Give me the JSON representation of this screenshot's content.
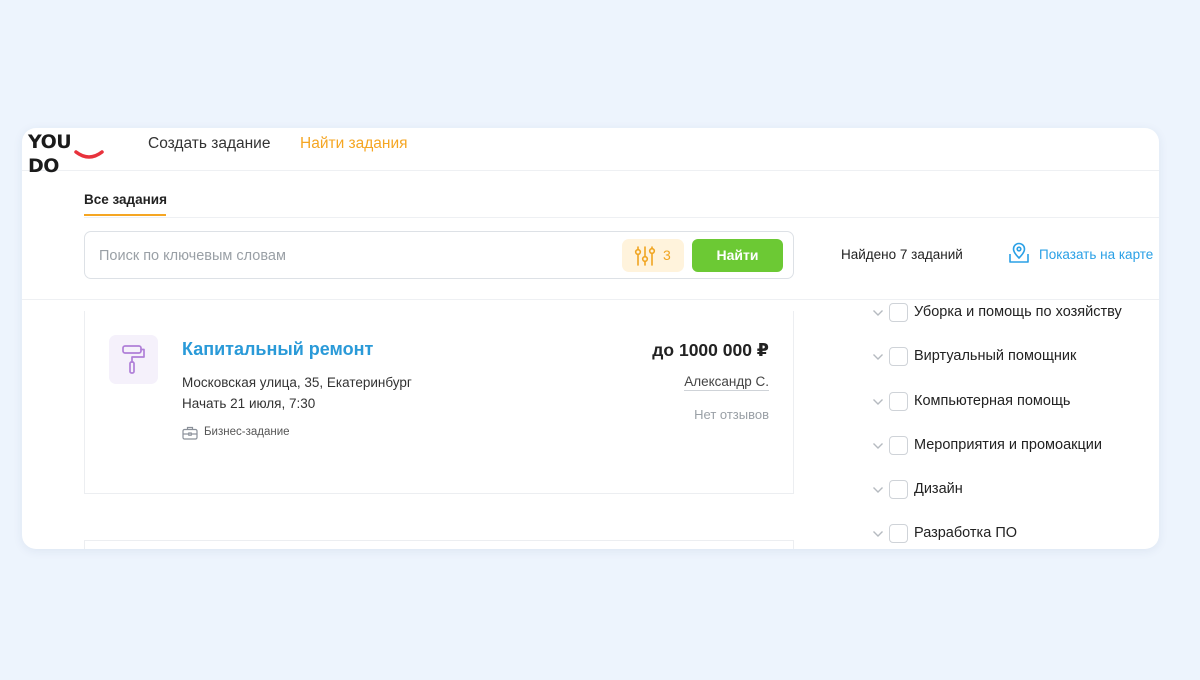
{
  "header": {
    "logo_text": "YOU DO",
    "nav": {
      "create_task": "Создать задание",
      "find_tasks": "Найти задания"
    }
  },
  "tabs": {
    "all_tasks": "Все задания"
  },
  "search": {
    "placeholder": "Поиск по ключевым словам",
    "value": "",
    "filter_count": "3",
    "find_button": "Найти"
  },
  "results": {
    "found_text": "Найдено 7 заданий",
    "show_on_map": "Показать на карте"
  },
  "task": {
    "title": "Капитальный ремонт",
    "address": "Московская улица, 35, Екатеринбург",
    "start": "Начать 21 июля, 7:30",
    "badge": "Бизнес-задание",
    "price": "до 1000 000 ₽",
    "author": "Александр С.",
    "reviews": "Нет отзывов"
  },
  "categories": [
    {
      "label": "Уборка и помощь по хозяйству",
      "checked": false
    },
    {
      "label": "Виртуальный помощник",
      "checked": false
    },
    {
      "label": "Компьютерная помощь",
      "checked": false
    },
    {
      "label": "Мероприятия и промоакции",
      "checked": false
    },
    {
      "label": "Дизайн",
      "checked": false
    },
    {
      "label": "Разработка ПО",
      "checked": false
    }
  ],
  "colors": {
    "accent_orange": "#f5a623",
    "link_blue": "#2a9ad8",
    "button_green": "#6cc934",
    "logo_red": "#e8323c"
  }
}
